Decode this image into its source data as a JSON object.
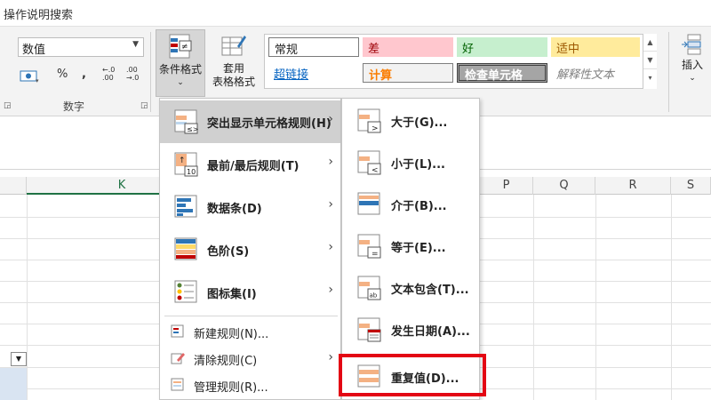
{
  "topbar": {
    "search_text": "操作说明搜索"
  },
  "ribbon": {
    "number_format": "数值",
    "percent": "%",
    "comma": ",",
    "inc_decimal": "←.0\n.00",
    "dec_decimal": ".00\n→.0",
    "number_group_label": "数字",
    "cf_line1": "条件格式",
    "table_line1": "套用",
    "table_line2": "表格格式",
    "insert_label": "插入",
    "styles": {
      "normal": "常规",
      "bad": "差",
      "good": "好",
      "neutral": "适中",
      "hyperlink": "超链接",
      "calculation": "计算",
      "check_cell": "检查单元格",
      "explanatory": "解释性文本"
    }
  },
  "columns": [
    "K",
    "P",
    "Q",
    "R",
    "S"
  ],
  "menu1": {
    "items": [
      {
        "label": "突出显示单元格规则(H)",
        "icon": "highlight-rules-icon"
      },
      {
        "label": "最前/最后规则(T)",
        "icon": "top-bottom-icon"
      },
      {
        "label": "数据条(D)",
        "icon": "data-bars-icon"
      },
      {
        "label": "色阶(S)",
        "icon": "color-scales-icon"
      },
      {
        "label": "图标集(I)",
        "icon": "icon-sets-icon"
      }
    ],
    "small_items": [
      {
        "label": "新建规则(N)..."
      },
      {
        "label": "清除规则(C)"
      },
      {
        "label": "管理规则(R)..."
      }
    ]
  },
  "menu2": {
    "items": [
      {
        "label": "大于(G)..."
      },
      {
        "label": "小于(L)..."
      },
      {
        "label": "介于(B)..."
      },
      {
        "label": "等于(E)..."
      },
      {
        "label": "文本包含(T)..."
      },
      {
        "label": "发生日期(A)..."
      },
      {
        "label": "重复值(D)..."
      }
    ]
  },
  "colors": {
    "excel_green": "#1f7244",
    "highlight_red": "#e30613",
    "bad_fill": "#ffc7ce",
    "good_fill": "#c6efce",
    "neutral_fill": "#ffeb9c",
    "calc_fill": "#f2f2f2",
    "check_fill": "#a5a5a5",
    "link_blue": "#0563c1"
  }
}
